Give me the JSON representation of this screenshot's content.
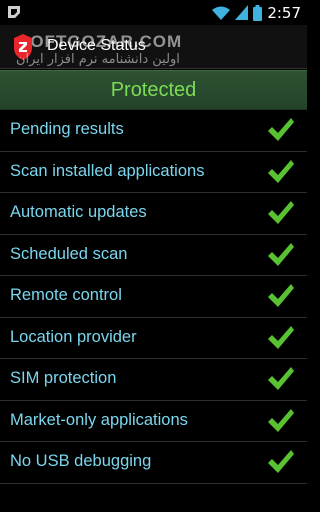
{
  "status_bar": {
    "time": "2:57",
    "icons": [
      "notification-icon",
      "wifi-icon",
      "signal-icon",
      "battery-icon"
    ]
  },
  "action_bar": {
    "title": "Device Status",
    "watermark_top": "SOFTGOZAR.COM",
    "watermark_bottom": "اولین دانشنامه نرم افزار ایران"
  },
  "banner": {
    "text": "Protected",
    "color": "#7bdc55"
  },
  "items": [
    {
      "label": "Pending results",
      "status": "ok"
    },
    {
      "label": "Scan installed applications",
      "status": "ok"
    },
    {
      "label": "Automatic updates",
      "status": "ok"
    },
    {
      "label": "Scheduled scan",
      "status": "ok"
    },
    {
      "label": "Remote control",
      "status": "ok"
    },
    {
      "label": "Location provider",
      "status": "ok"
    },
    {
      "label": "SIM protection",
      "status": "ok"
    },
    {
      "label": "Market-only applications",
      "status": "ok"
    },
    {
      "label": "No USB debugging",
      "status": "ok"
    }
  ],
  "colors": {
    "label": "#7bd6ee",
    "check": "#59c233",
    "brand": "#e8262b"
  }
}
